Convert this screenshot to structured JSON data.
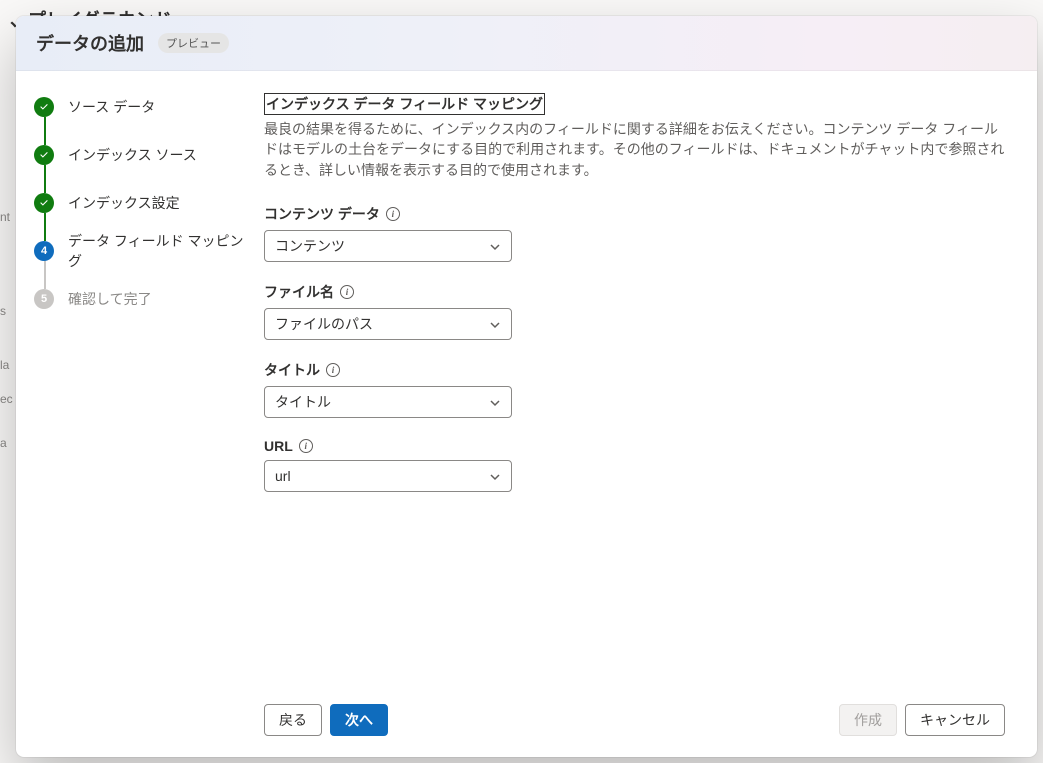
{
  "background": {
    "page_title": "、プレイグラウンド",
    "left_items": [
      "nt",
      "s",
      "la",
      "ec",
      "a"
    ]
  },
  "modal": {
    "title": "データの追加",
    "badge": "プレビュー"
  },
  "stepper": {
    "items": [
      {
        "label": "ソース データ",
        "state": "done"
      },
      {
        "label": "インデックス ソース",
        "state": "done"
      },
      {
        "label": "インデックス設定",
        "state": "done"
      },
      {
        "label": "データ フィールド マッピング",
        "state": "current",
        "num": "4"
      },
      {
        "label": "確認して完了",
        "state": "future",
        "num": "5"
      }
    ]
  },
  "main": {
    "title": "インデックス データ フィールド マッピング",
    "description": "最良の結果を得るために、インデックス内のフィールドに関する詳細をお伝えください。コンテンツ データ フィールドはモデルの土台をデータにする目的で利用されます。その他のフィールドは、ドキュメントがチャット内で参照されるとき、詳しい情報を表示する目的で使用されます。",
    "fields": [
      {
        "label": "コンテンツ データ",
        "value": "コンテンツ"
      },
      {
        "label": "ファイル名",
        "value": "ファイルのパス"
      },
      {
        "label": "タイトル",
        "value": "タイトル"
      },
      {
        "label": "URL",
        "value": "url"
      }
    ]
  },
  "footer": {
    "back": "戻る",
    "next": "次へ",
    "create": "作成",
    "cancel": "キャンセル"
  }
}
